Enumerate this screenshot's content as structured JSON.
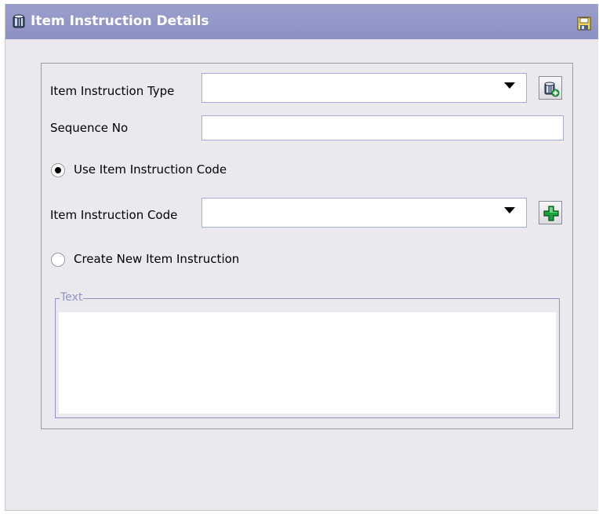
{
  "header": {
    "title": "Item Instruction Details",
    "title_icon": "item-instruction-icon",
    "save_icon": "save-icon"
  },
  "form": {
    "item_instruction_type": {
      "label": "Item Instruction Type",
      "value": "",
      "button_icon": "item-lookup-icon"
    },
    "sequence_no": {
      "label": "Sequence No",
      "value": ""
    },
    "use_code_option": {
      "label": "Use Item Instruction Code",
      "selected": true
    },
    "item_instruction_code": {
      "label": "Item Instruction Code",
      "value": "",
      "button_icon": "add-icon"
    },
    "create_new_option": {
      "label": "Create New Item Instruction",
      "selected": false
    },
    "text": {
      "legend": "Text",
      "value": ""
    }
  },
  "colors": {
    "title_bar": "#9a9fcd",
    "window_bg": "#ebe9ed",
    "field_border": "#a5acd6",
    "add_icon": "#1aa33b"
  }
}
